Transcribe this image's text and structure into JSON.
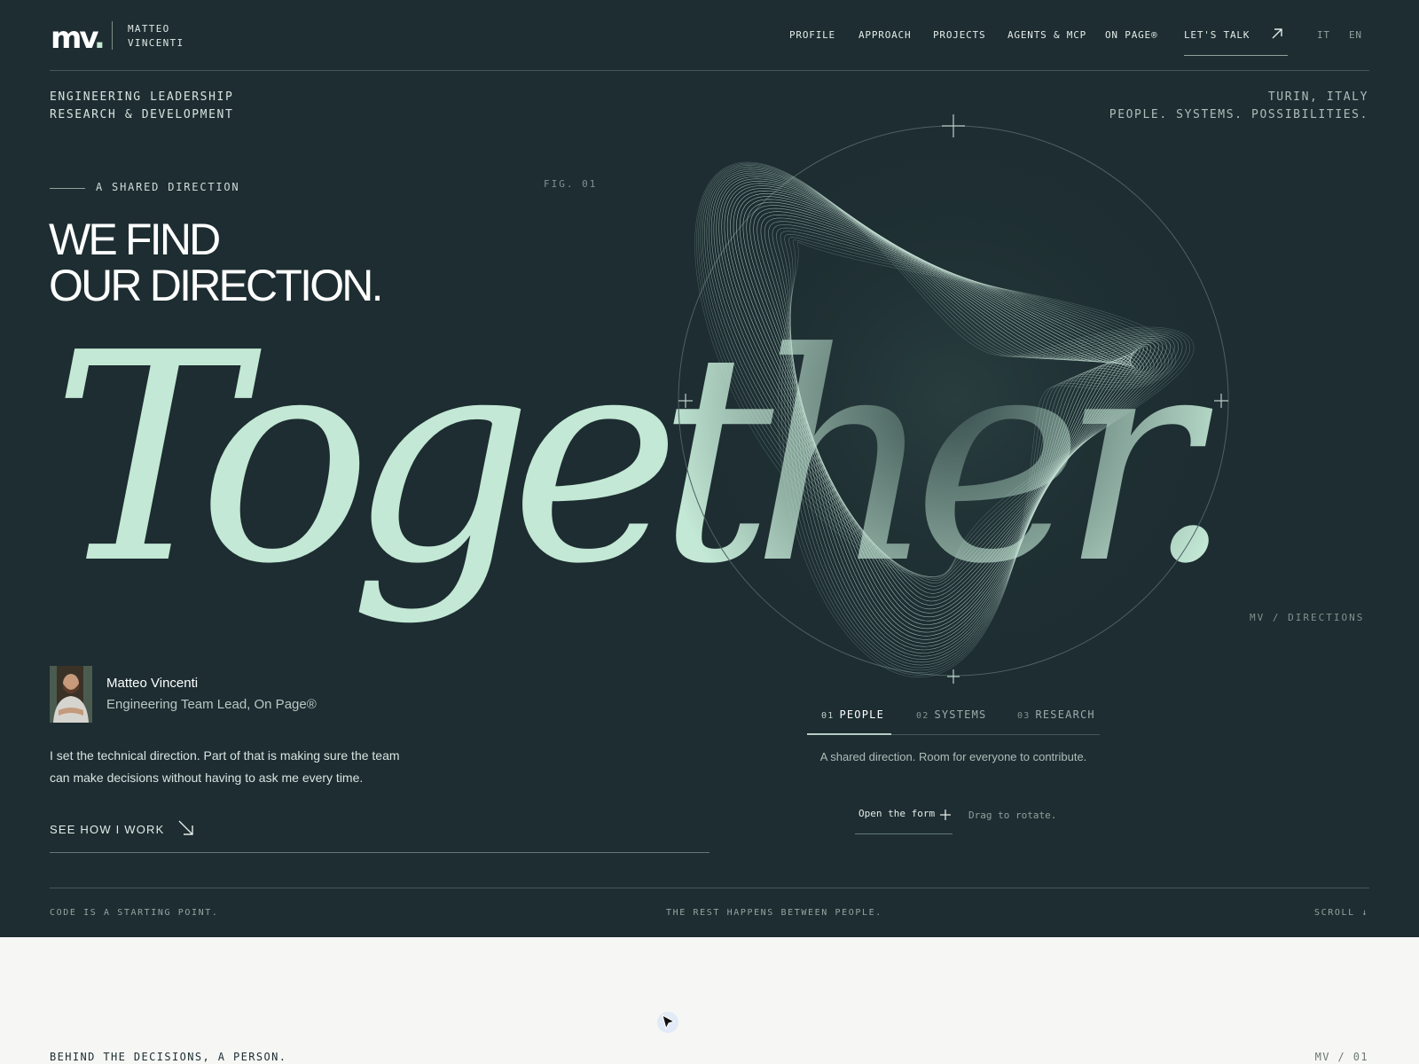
{
  "brand": {
    "logo": "mv",
    "logo_dot": ".",
    "name_line1": "MATTEO",
    "name_line2": "VINCENTI"
  },
  "nav": {
    "items": [
      "PROFILE",
      "APPROACH",
      "PROJECTS",
      "AGENTS & MCP",
      "ON PAGE®"
    ],
    "cta": "LET'S TALK",
    "langs": [
      "IT",
      "EN"
    ]
  },
  "meta": {
    "left_line1": "ENGINEERING LEADERSHIP",
    "left_line2": "RESEARCH & DEVELOPMENT",
    "right_line1": "TURIN, ITALY",
    "right_line2": "PEOPLE. SYSTEMS. POSSIBILITIES."
  },
  "hero": {
    "eyebrow": "A SHARED DIRECTION",
    "fig_label": "FIG. 01",
    "headline_line1": "WE FIND",
    "headline_line2": "OUR DIRECTION.",
    "big_word": "Together.",
    "figure_caption": "MV / DIRECTIONS"
  },
  "profile": {
    "name": "Matteo Vincenti",
    "role": "Engineering Team Lead, On Page®",
    "bio": "I set the technical direction. Part of that is making sure the team can make decisions without having to ask me every time.",
    "cta": "SEE HOW I WORK"
  },
  "tabs": {
    "items": [
      {
        "num": "01",
        "label": "PEOPLE"
      },
      {
        "num": "02",
        "label": "SYSTEMS"
      },
      {
        "num": "03",
        "label": "RESEARCH"
      }
    ],
    "active_index": 0,
    "description": "A shared direction. Room for everyone to contribute.",
    "open_form": "Open the form",
    "drag_hint": "Drag to rotate."
  },
  "footer": {
    "left": "CODE IS A STARTING POINT.",
    "center": "THE REST HAPPENS BETWEEN PEOPLE.",
    "right": "SCROLL ↓"
  },
  "next_section": {
    "left": "BEHIND THE DECISIONS, A PERSON.",
    "right": "MV / 01"
  },
  "colors": {
    "background": "#1d2d31",
    "accent_mint": "#c3e8d5",
    "text": "#e9f1ee",
    "light_section": "#f6f7f5"
  }
}
